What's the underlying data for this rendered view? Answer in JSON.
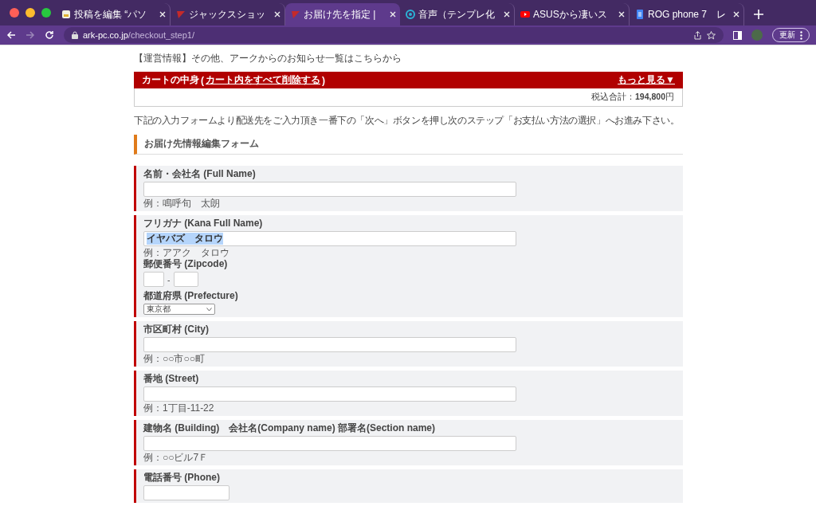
{
  "browser": {
    "tabs": [
      {
        "kind": "doc",
        "title": "投稿を編集 “パソ",
        "selected": false
      },
      {
        "kind": "flag",
        "title": "ジャックスショッ",
        "selected": false
      },
      {
        "kind": "flag",
        "title": "お届け先を指定 |",
        "selected": true
      },
      {
        "kind": "audio",
        "title": "音声（テンプレ化",
        "selected": false
      },
      {
        "kind": "video",
        "title": "ASUSから凄いス",
        "selected": false
      },
      {
        "kind": "sheet",
        "title": "ROG phone 7　レ",
        "selected": false
      }
    ],
    "url_host": "ark-pc.co.jp",
    "url_path": "/checkout_step1/",
    "update_label": "更新"
  },
  "notice": "【運営情報】その他、アークからのお知らせ一覧はこちらから",
  "cart": {
    "title": "カートの中身",
    "bracket_open": "(",
    "clear_link": "カート内をすべて削除する",
    "bracket_close": ")",
    "more_link": "もっと見る▼",
    "total_label": "税込合計：",
    "total_value": "194,800",
    "total_unit": "円"
  },
  "instruction": "下記の入力フォームより配送先をご入力頂き一番下の「次へ」ボタンを押し次のステップ「お支払い方法の選択」へお進み下さい。",
  "section_title": "お届け先情報編集フォーム",
  "groups": [
    {
      "fields": [
        {
          "kind": "text",
          "label": "名前・会社名 (Full Name)",
          "example": "例：鳴呼旬　太朗"
        }
      ]
    },
    {
      "fields": [
        {
          "kind": "text",
          "label": "フリガナ (Kana Full Name)",
          "value": "イヤバズ　タロウ",
          "highlighted": true,
          "example": "例：アアク　タロウ"
        },
        {
          "kind": "zip",
          "label": "郵便番号 (Zipcode)",
          "separator": "-"
        },
        {
          "kind": "select",
          "label": "都道府県 (Prefecture)",
          "value": "東京都"
        }
      ]
    },
    {
      "fields": [
        {
          "kind": "text",
          "label": "市区町村 (City)",
          "example": "例：○○市○○町"
        }
      ]
    },
    {
      "fields": [
        {
          "kind": "text",
          "label": "番地 (Street)",
          "example": "例：1丁目-11-22"
        }
      ]
    },
    {
      "fields": [
        {
          "kind": "text",
          "label": "建物名 (Building)　会社名(Company name) 部署名(Section name)",
          "example": "例：○○ビル7Ｆ"
        }
      ]
    },
    {
      "fields": [
        {
          "kind": "short",
          "label": "電話番号 (Phone)"
        }
      ]
    }
  ]
}
